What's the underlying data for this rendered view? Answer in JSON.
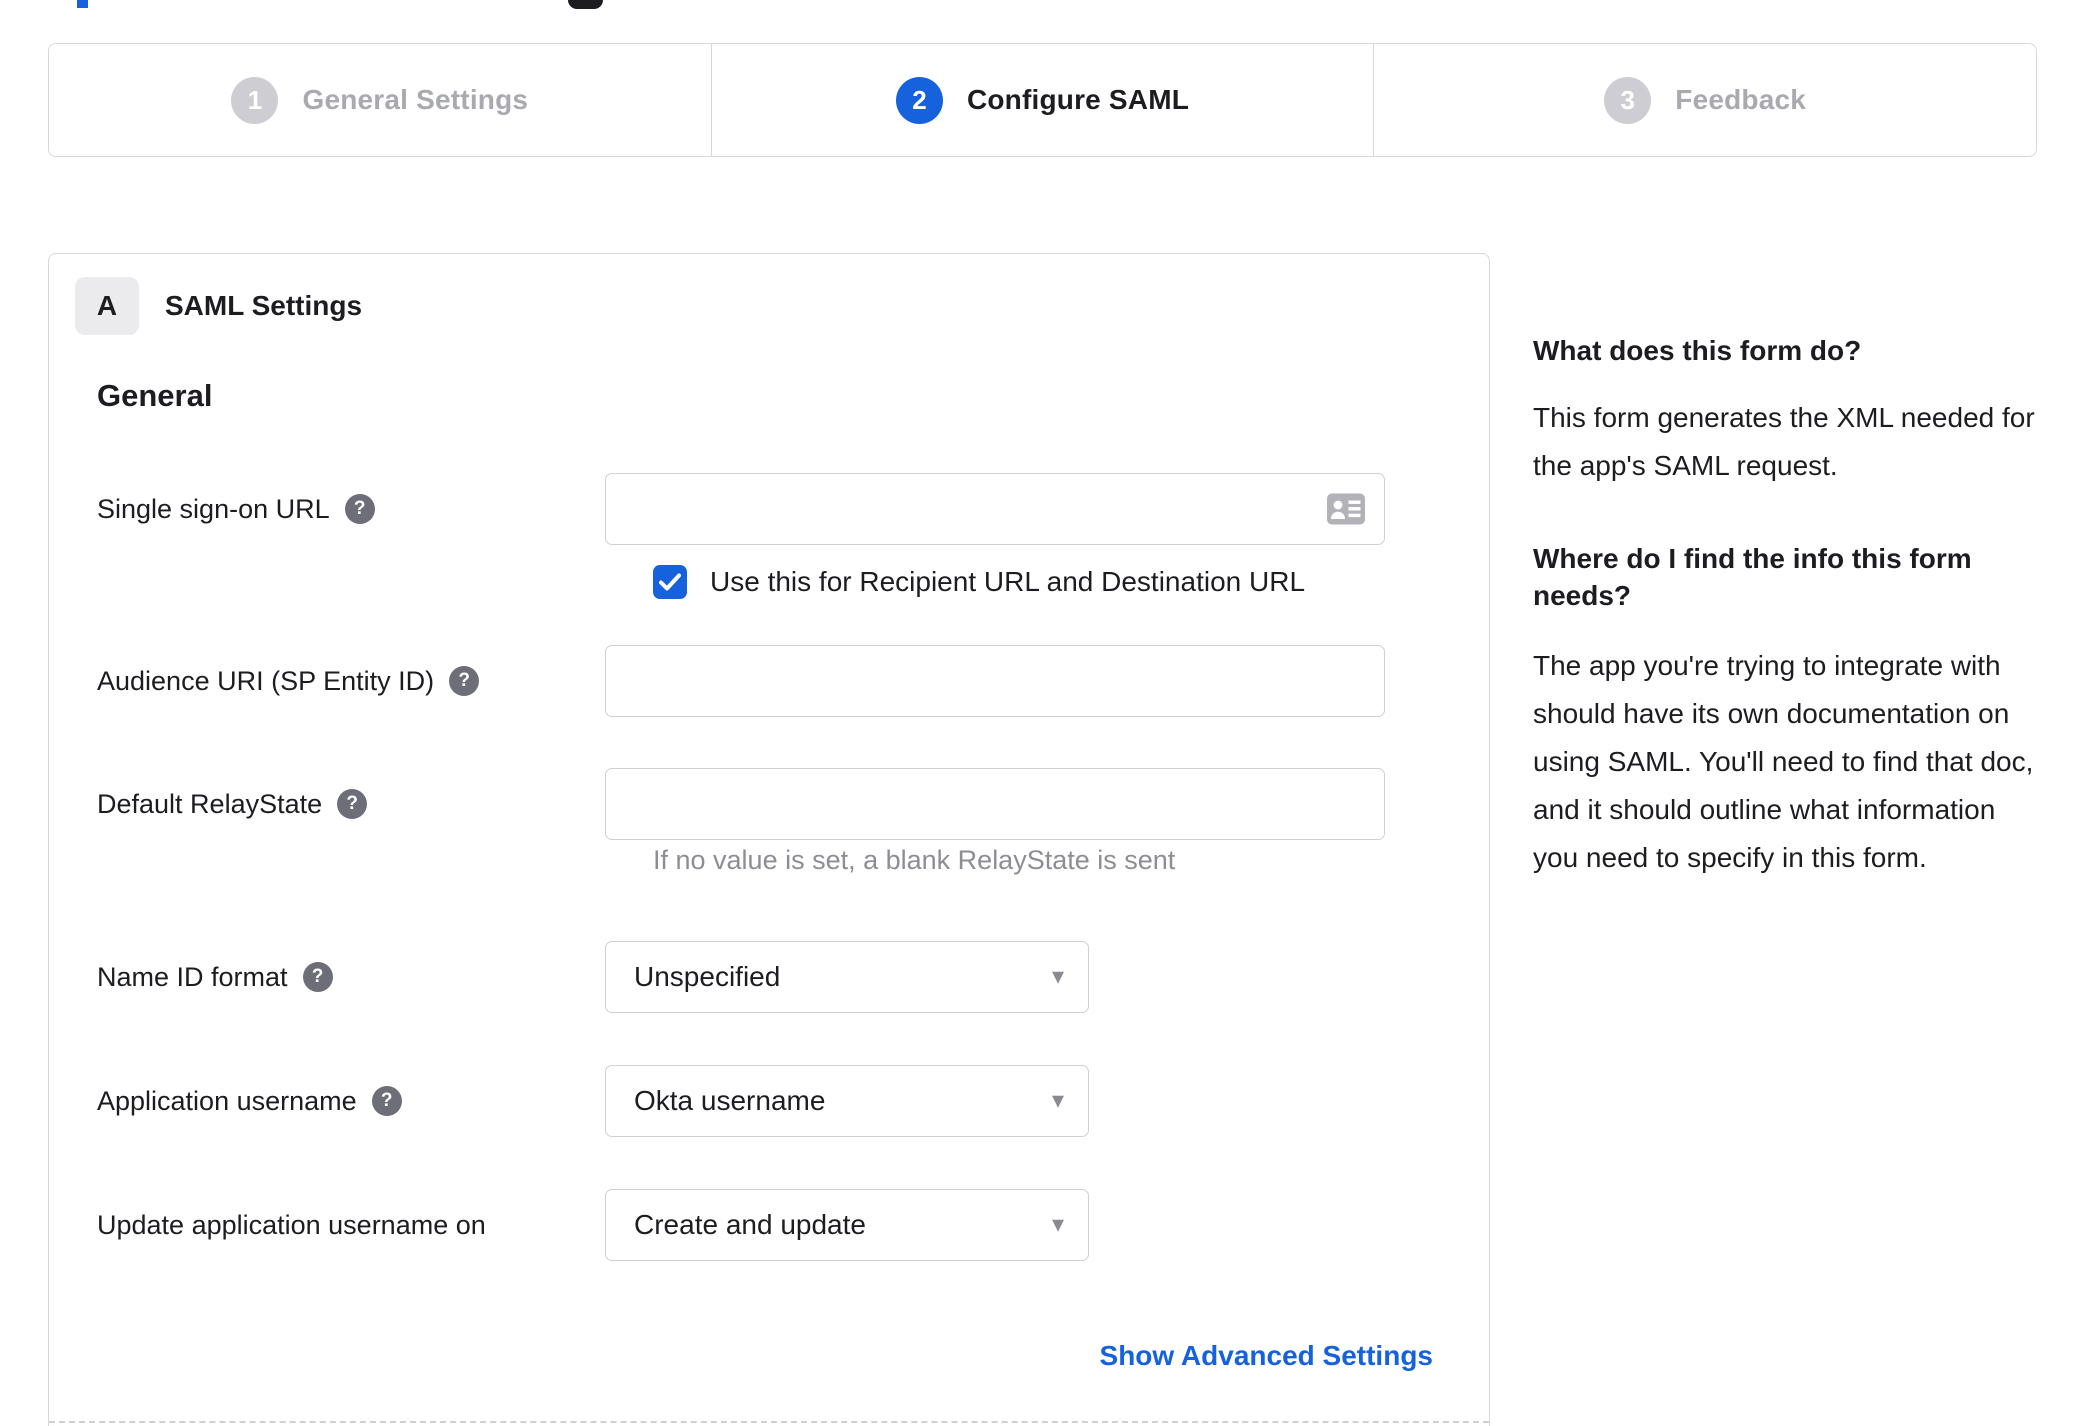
{
  "theme": {
    "accent_blue": "#1662dd",
    "text_dark": "#1d1d21",
    "inactive_gray": "#a9a9b2",
    "border_gray": "#d7d7dc",
    "help_icon_gray": "#6e6e78",
    "hint_gray": "#8d8d95",
    "badge_bg": "#ebebed"
  },
  "icons": {
    "help": "?",
    "check": "✓",
    "caret_down": "▾",
    "contact_card": "id-card"
  },
  "stepper": {
    "steps": [
      {
        "number": "1",
        "label": "General Settings",
        "state": "inactive"
      },
      {
        "number": "2",
        "label": "Configure SAML",
        "state": "active"
      },
      {
        "number": "3",
        "label": "Feedback",
        "state": "inactive"
      }
    ]
  },
  "panel": {
    "badge": "A",
    "title": "SAML Settings",
    "section_heading": "General",
    "fields": [
      {
        "label": "Single sign-on URL",
        "type": "text",
        "value": "",
        "has_help": true
      },
      {
        "label": "Audience URI (SP Entity ID)",
        "type": "text",
        "value": "",
        "has_help": true
      },
      {
        "label": "Default RelayState",
        "type": "text",
        "value": "",
        "has_help": true,
        "hint": "If no value is set, a blank RelayState is sent"
      },
      {
        "label": "Name ID format",
        "type": "select",
        "value": "Unspecified",
        "has_help": true
      },
      {
        "label": "Application username",
        "type": "select",
        "value": "Okta username",
        "has_help": true
      },
      {
        "label": "Update application username on",
        "type": "select",
        "value": "Create and update",
        "has_help": false
      }
    ],
    "sso_checkbox": {
      "label": "Use this for Recipient URL and Destination URL",
      "checked": true
    },
    "advanced_link": "Show Advanced Settings"
  },
  "sidebar": {
    "heading_1": "What does this form do?",
    "para_1": "This form generates the XML needed for the app's SAML request.",
    "heading_2": "Where do I find the info this form needs?",
    "para_2": "The app you're trying to integrate with should have its own documentation on using SAML. You'll need to find that doc, and it should outline what information you need to specify in this form."
  }
}
